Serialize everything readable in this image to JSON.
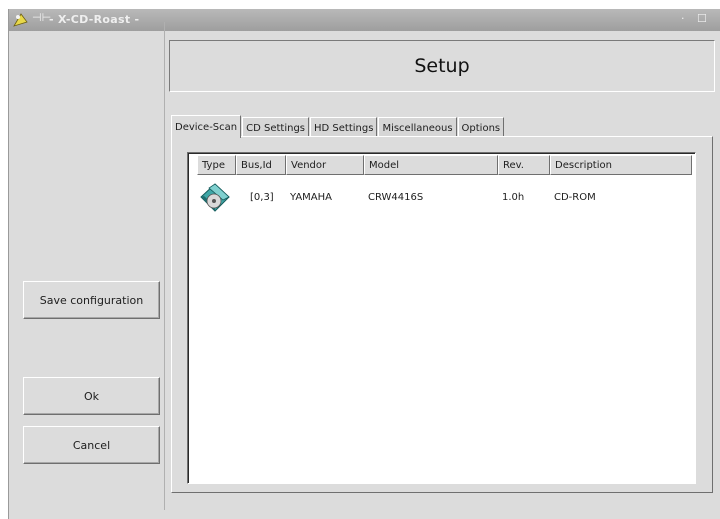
{
  "window": {
    "title": "- X-CD-Roast -",
    "pin_glyph": "⊣⊢",
    "min_glyph": "·",
    "max_glyph": "☐"
  },
  "left_panel": {
    "save_label": "Save configuration",
    "ok_label": "Ok",
    "cancel_label": "Cancel"
  },
  "main": {
    "title": "Setup",
    "tabs": [
      {
        "label": "Device-Scan",
        "active": true
      },
      {
        "label": "CD Settings",
        "active": false
      },
      {
        "label": "HD Settings",
        "active": false
      },
      {
        "label": "Miscellaneous",
        "active": false
      },
      {
        "label": "Options",
        "active": false
      }
    ],
    "devices": {
      "columns": [
        "Type",
        "Bus,Id",
        "Vendor",
        "Model",
        "Rev.",
        "Description"
      ],
      "rows": [
        {
          "type_icon": "cdrom-drive-icon",
          "bus_id": "[0,3]",
          "vendor": "YAMAHA",
          "model": "CRW4416S",
          "rev": "1.0h",
          "description": "CD-ROM"
        }
      ]
    }
  }
}
